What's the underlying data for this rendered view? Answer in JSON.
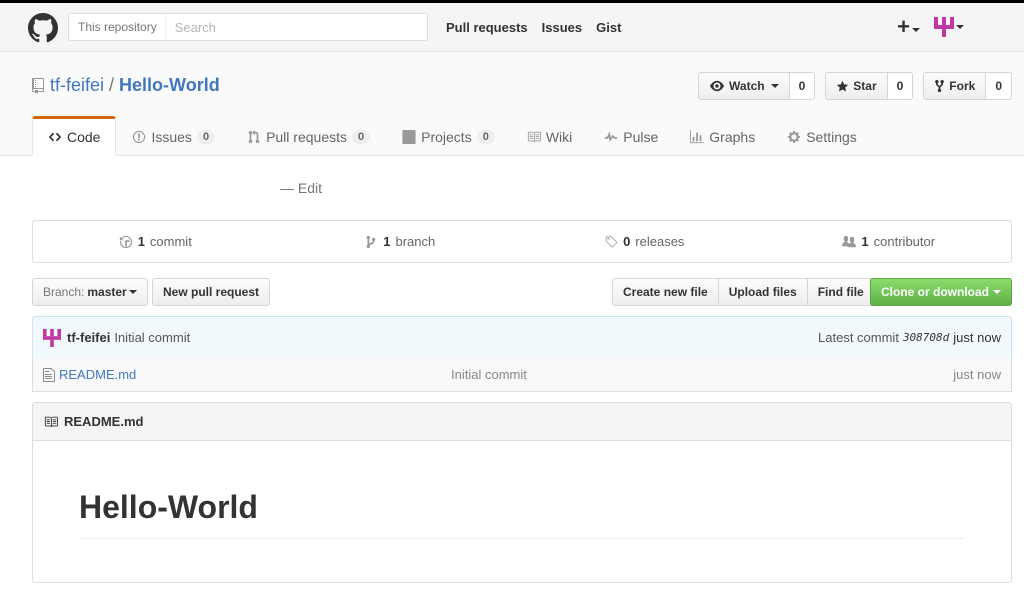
{
  "header": {
    "search_scope": "This repository",
    "search_placeholder": "Search",
    "nav": [
      "Pull requests",
      "Issues",
      "Gist"
    ]
  },
  "repo": {
    "owner": "tf-feifei",
    "separator": "/",
    "name": "Hello-World",
    "watch_label": "Watch",
    "watch_count": "0",
    "star_label": "Star",
    "star_count": "0",
    "fork_label": "Fork",
    "fork_count": "0"
  },
  "tabs": [
    {
      "label": "Code",
      "counter": null
    },
    {
      "label": "Issues",
      "counter": "0"
    },
    {
      "label": "Pull requests",
      "counter": "0"
    },
    {
      "label": "Projects",
      "counter": "0"
    },
    {
      "label": "Wiki",
      "counter": null
    },
    {
      "label": "Pulse",
      "counter": null
    },
    {
      "label": "Graphs",
      "counter": null
    },
    {
      "label": "Settings",
      "counter": null
    }
  ],
  "description": {
    "edit": "— Edit"
  },
  "summary": {
    "commits_num": "1",
    "commits_label": "commit",
    "branches_num": "1",
    "branches_label": "branch",
    "releases_num": "0",
    "releases_label": "releases",
    "contributors_num": "1",
    "contributors_label": "contributor"
  },
  "filebar": {
    "branch_label": "Branch:",
    "branch_value": "master",
    "new_pr": "New pull request",
    "create_file": "Create new file",
    "upload_files": "Upload files",
    "find_file": "Find file",
    "clone": "Clone or download"
  },
  "commit": {
    "author": "tf-feifei",
    "message": "Initial commit",
    "latest_label": "Latest commit",
    "sha": "308708d",
    "age": "just now"
  },
  "files": [
    {
      "name": "README.md",
      "message": "Initial commit",
      "age": "just now"
    }
  ],
  "readme": {
    "title": "README.md",
    "heading": "Hello-World"
  },
  "colors": {
    "accent": "#4078c0",
    "tab_accent": "#d26911",
    "clone_green": "#6cc644",
    "avatar": "#c036a3"
  }
}
